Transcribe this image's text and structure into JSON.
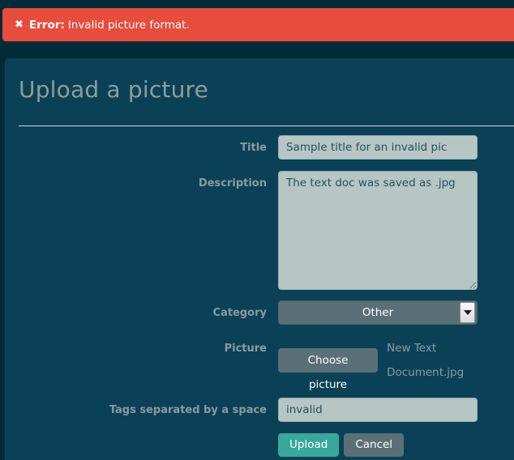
{
  "alert": {
    "icon": "close-x-icon",
    "strong": "Error:",
    "message": "Invalid picture format.",
    "background_color": "#e74c3c",
    "text_color": "#ffffff"
  },
  "page": {
    "title": "Upload a picture",
    "panel_color": "#0b4156",
    "background_color": "#012b38",
    "title_color": "#8d9e9a"
  },
  "form": {
    "title": {
      "label": "Title",
      "value": "Sample title for an invalid pic",
      "placeholder": ""
    },
    "description": {
      "label": "Description",
      "value": "The text doc was saved as .jpg",
      "placeholder": ""
    },
    "category": {
      "label": "Category",
      "selected": "Other",
      "arrow_icon": "chevron-down-icon"
    },
    "picture": {
      "label": "Picture",
      "button_label": "Choose picture",
      "filename": "New Text Document.jpg"
    },
    "tags": {
      "label": "Tags separated by a space",
      "value": "invalid",
      "placeholder": ""
    }
  },
  "actions": {
    "upload_label": "Upload",
    "cancel_label": "Cancel",
    "upload_color": "#37a89b",
    "cancel_color": "#5b7076"
  }
}
